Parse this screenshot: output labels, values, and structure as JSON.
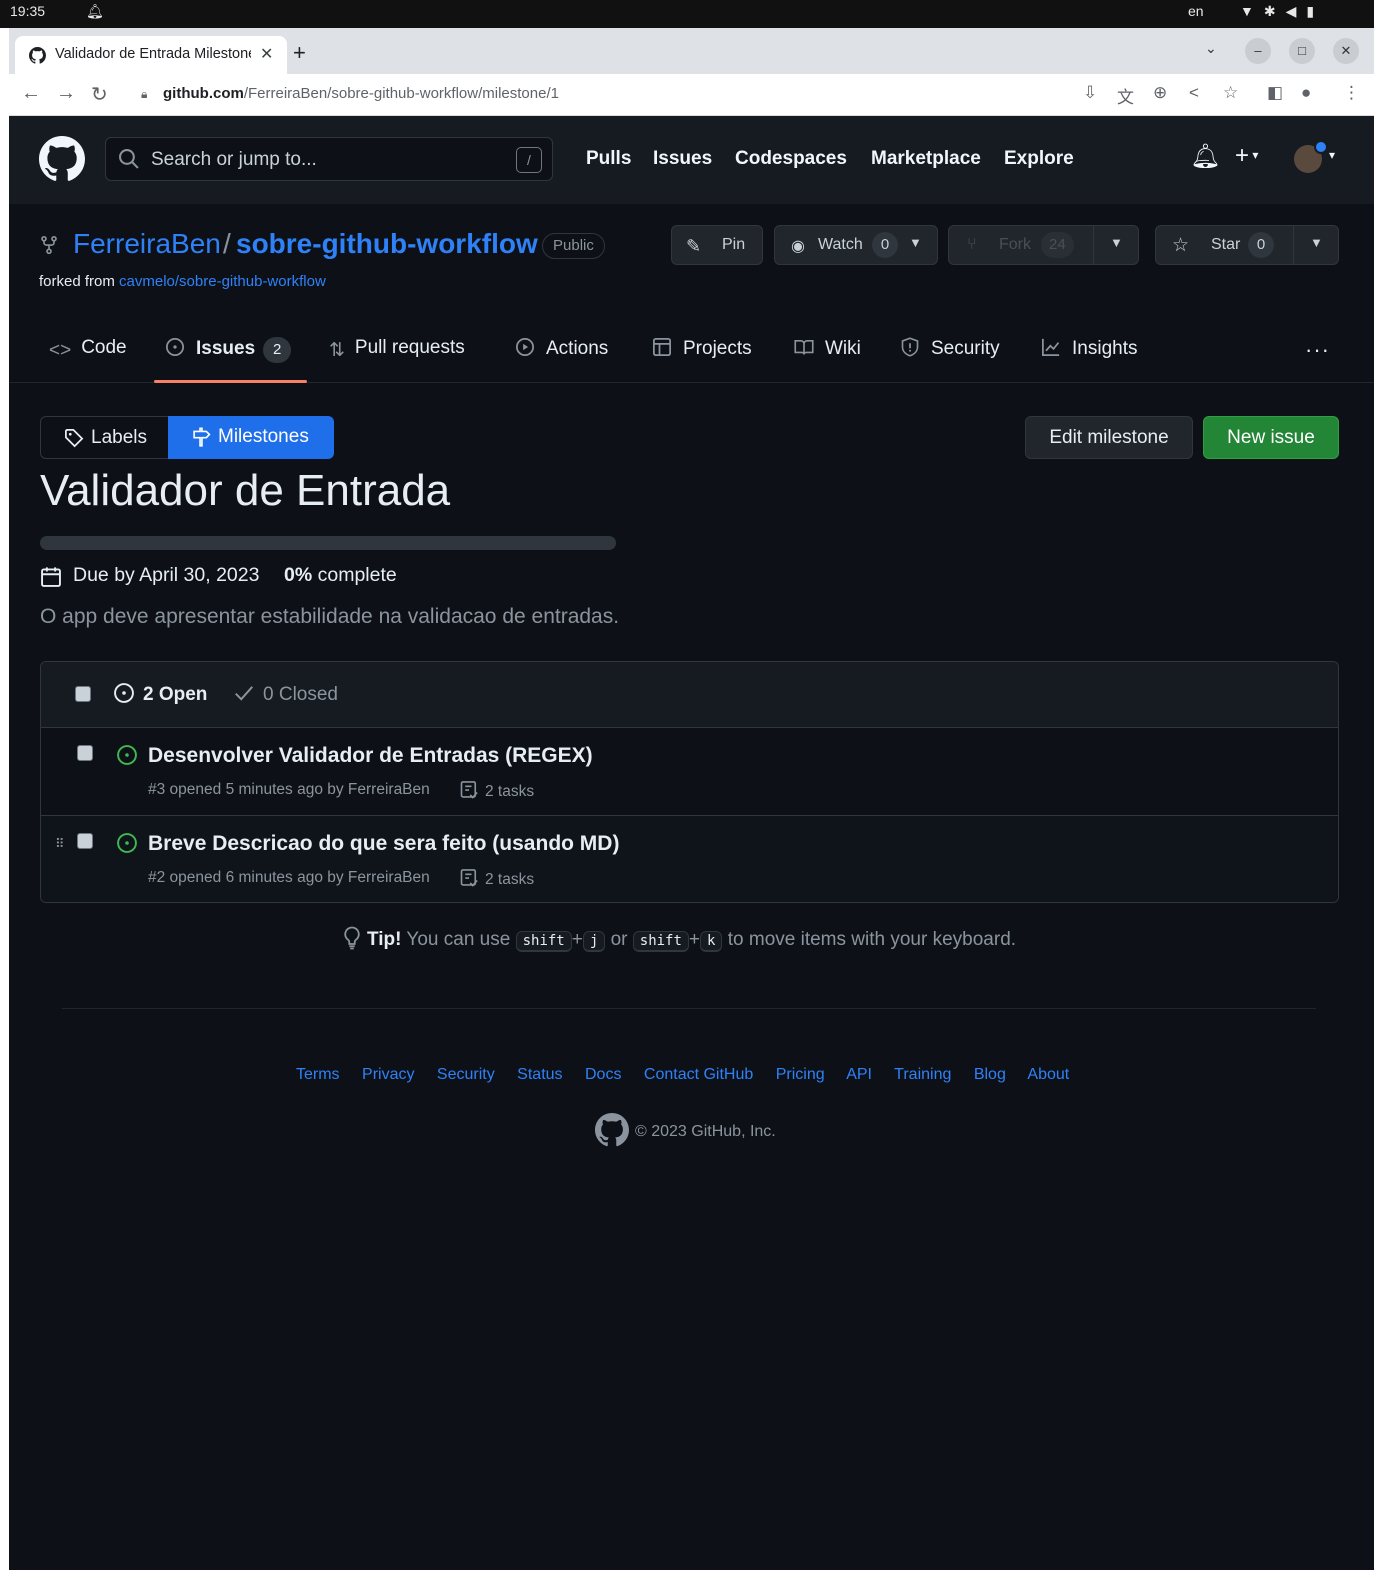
{
  "os": {
    "time": "19:35",
    "lang": "en"
  },
  "browser": {
    "tab_title": "Validador de Entrada Milestone",
    "url_host": "github.com",
    "url_path": "/FerreiraBen/sobre-github-workflow/milestone/1"
  },
  "header": {
    "search_placeholder": "Search or jump to...",
    "slash_key": "/",
    "nav": [
      "Pulls",
      "Issues",
      "Codespaces",
      "Marketplace",
      "Explore"
    ]
  },
  "repo": {
    "owner": "FerreiraBen",
    "separator": "/",
    "name": "sobre-github-workflow",
    "visibility": "Public",
    "forked_prefix": "forked from",
    "forked_from": "cavmelo/sobre-github-workflow",
    "pin_label": "Pin",
    "watch_label": "Watch",
    "watch_count": "0",
    "fork_label": "Fork",
    "fork_count": "24",
    "star_label": "Star",
    "star_count": "0"
  },
  "tabs": {
    "code": "Code",
    "issues": "Issues",
    "issues_count": "2",
    "pulls": "Pull requests",
    "actions": "Actions",
    "projects": "Projects",
    "wiki": "Wiki",
    "security": "Security",
    "insights": "Insights"
  },
  "toolbar": {
    "labels": "Labels",
    "milestones": "Milestones",
    "edit_milestone": "Edit milestone",
    "new_issue": "New issue"
  },
  "milestone": {
    "title": "Validador de Entrada",
    "progress_fraction": 0,
    "due": "Due by April 30, 2023",
    "percent": "0%",
    "percent_suffix": "complete",
    "description": "O app deve apresentar estabilidade na validacao de entradas."
  },
  "issues_box": {
    "open_label": "2 Open",
    "closed_label": "0 Closed",
    "items": [
      {
        "title": "Desenvolver Validador de Entradas (REGEX)",
        "meta": "#3 opened 5 minutes ago by FerreiraBen",
        "tasks": "2 tasks"
      },
      {
        "title": "Breve Descricao do que sera feito (usando MD)",
        "meta": "#2 opened 6 minutes ago by FerreiraBen",
        "tasks": "2 tasks"
      }
    ]
  },
  "tip": {
    "strong": "Tip!",
    "text1": "You can use",
    "k_shift": "shift",
    "plus": "+",
    "k_j": "j",
    "or": "or",
    "k_k": "k",
    "text2": "to move items with your keyboard."
  },
  "footer": {
    "links": [
      "Terms",
      "Privacy",
      "Security",
      "Status",
      "Docs",
      "Contact GitHub",
      "Pricing",
      "API",
      "Training",
      "Blog",
      "About"
    ],
    "copyright": "© 2023 GitHub, Inc."
  },
  "colors": {
    "bg": "#0d1117",
    "header_bg": "#161b22",
    "accent_blue": "#2f81f7",
    "selected_blue": "#1f6feb",
    "green": "#238636",
    "open_green": "#3fb950",
    "tab_underline": "#f78166"
  }
}
